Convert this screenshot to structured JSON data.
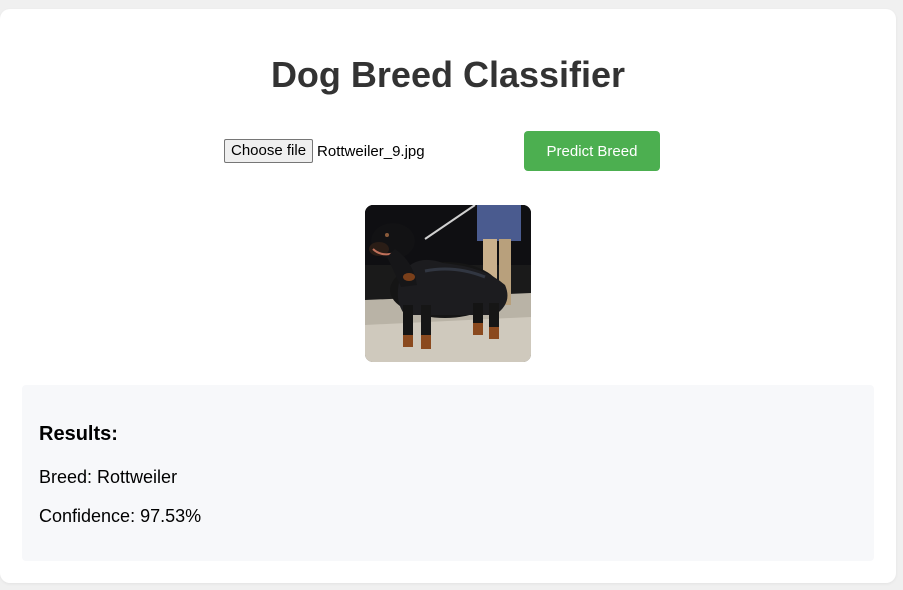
{
  "page": {
    "title": "Dog Breed Classifier"
  },
  "upload": {
    "choose_label": "Choose file",
    "file_name": "Rottweiler_9.jpg",
    "predict_label": "Predict Breed"
  },
  "preview": {
    "subject": "rottweiler-dog-photo"
  },
  "results": {
    "heading": "Results:",
    "breed_text": "Breed: Rottweiler",
    "confidence_text": "Confidence: 97.53%"
  },
  "colors": {
    "accent": "#4caf50",
    "title": "#333333",
    "results_bg": "#f7f8fa"
  }
}
